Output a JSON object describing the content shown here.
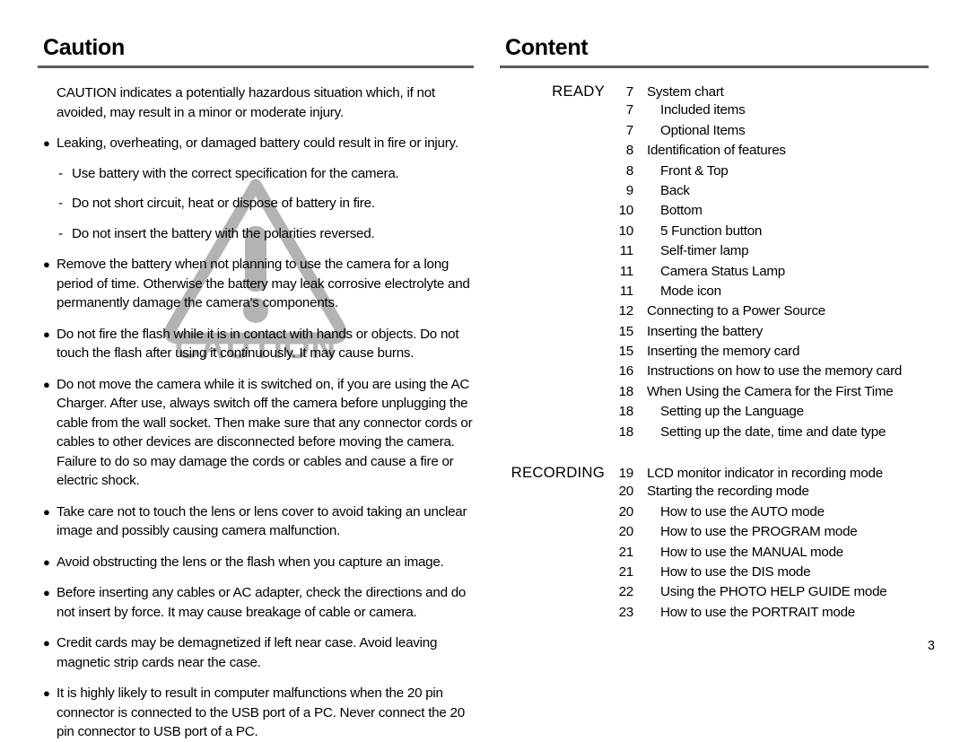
{
  "left": {
    "heading": "Caution",
    "intro": "CAUTION indicates a potentially hazardous situation which, if not avoided, may result in a minor or moderate injury.",
    "items": [
      {
        "type": "bullet",
        "text": "Leaking, overheating, or damaged battery could result in fire or injury."
      },
      {
        "type": "dash",
        "text": "Use battery with the correct specification for the camera."
      },
      {
        "type": "dash",
        "text": "Do not short circuit, heat or dispose of battery in fire."
      },
      {
        "type": "dash",
        "text": "Do not insert the battery with the polarities reversed."
      },
      {
        "type": "bullet",
        "text": "Remove the battery when not planning to use the camera for a long period of time. Otherwise the battery may leak corrosive electrolyte and permanently damage the camera's components."
      },
      {
        "type": "bullet",
        "text": "Do not fire the flash while it is in contact with hands or objects. Do not touch the flash after using it continuously. It may cause burns."
      },
      {
        "type": "bullet",
        "text": "Do not move the camera while it is switched on, if you are using the AC Charger. After use, always switch off the camera before unplugging the cable from the wall socket. Then make sure that any connector cords or cables to other devices are disconnected before moving the camera. Failure to do so may damage the cords or cables and cause a fire or electric shock."
      },
      {
        "type": "bullet",
        "text": "Take care not to touch the lens or lens cover to avoid taking an unclear image and possibly causing camera malfunction."
      },
      {
        "type": "bullet",
        "text": "Avoid obstructing the lens or the flash when you capture an image."
      },
      {
        "type": "bullet",
        "text": "Before inserting any cables or AC adapter, check the directions and do not insert by force. It may cause breakage of cable or camera."
      },
      {
        "type": "bullet",
        "text": "Credit cards may be demagnetized if left near case. Avoid leaving magnetic strip cards near the case."
      },
      {
        "type": "bullet",
        "text": "It is highly likely to result in computer malfunctions when the 20 pin connector is connected to the USB port of a PC. Never connect the 20 pin connector to USB port of a PC."
      }
    ],
    "bullet_glyph": "●",
    "dash_glyph": "-",
    "watermark": {
      "label": "CAUTION",
      "icon": "warning-triangle-icon",
      "color": "#b3b3b3"
    }
  },
  "right": {
    "heading": "Content",
    "sections": [
      {
        "label": "READY",
        "entries": [
          {
            "page": "7",
            "title": "System chart",
            "level": 1
          },
          {
            "page": "7",
            "title": "Included items",
            "level": 2
          },
          {
            "page": "7",
            "title": "Optional Items",
            "level": 2
          },
          {
            "page": "8",
            "title": "Identification of features",
            "level": 1
          },
          {
            "page": "8",
            "title": "Front & Top",
            "level": 2
          },
          {
            "page": "9",
            "title": "Back",
            "level": 2
          },
          {
            "page": "10",
            "title": "Bottom",
            "level": 2
          },
          {
            "page": "10",
            "title": "5 Function button",
            "level": 2
          },
          {
            "page": "11",
            "title": "Self-timer lamp",
            "level": 2
          },
          {
            "page": "11",
            "title": "Camera Status Lamp",
            "level": 2
          },
          {
            "page": "11",
            "title": "Mode icon",
            "level": 2
          },
          {
            "page": "12",
            "title": "Connecting to a Power Source",
            "level": 1
          },
          {
            "page": "15",
            "title": "Inserting the battery",
            "level": 1
          },
          {
            "page": "15",
            "title": "Inserting the memory card",
            "level": 1
          },
          {
            "page": "16",
            "title": "Instructions on how to use the memory card",
            "level": 1
          },
          {
            "page": "18",
            "title": "When Using the Camera for the First Time",
            "level": 1
          },
          {
            "page": "18",
            "title": "Setting up the Language",
            "level": 2
          },
          {
            "page": "18",
            "title": "Setting up the date, time and date type",
            "level": 2
          }
        ]
      },
      {
        "label": "RECORDING",
        "entries": [
          {
            "page": "19",
            "title": "LCD monitor indicator in recording mode",
            "level": 1
          },
          {
            "page": "20",
            "title": "Starting the recording mode",
            "level": 1
          },
          {
            "page": "20",
            "title": "How to use the AUTO mode",
            "level": 2
          },
          {
            "page": "20",
            "title": "How to use the PROGRAM mode",
            "level": 2
          },
          {
            "page": "21",
            "title": "How to use the MANUAL mode",
            "level": 2
          },
          {
            "page": "21",
            "title": "How to use the DIS mode",
            "level": 2
          },
          {
            "page": "22",
            "title": "Using the PHOTO HELP GUIDE mode",
            "level": 2
          },
          {
            "page": "23",
            "title": "How to use the PORTRAIT mode",
            "level": 2
          }
        ]
      }
    ]
  },
  "footer": {
    "page_number": "3"
  },
  "colors": {
    "rule": "#5c5c5c",
    "text": "#000000",
    "watermark": "#b3b3b3",
    "background": "#ffffff"
  }
}
